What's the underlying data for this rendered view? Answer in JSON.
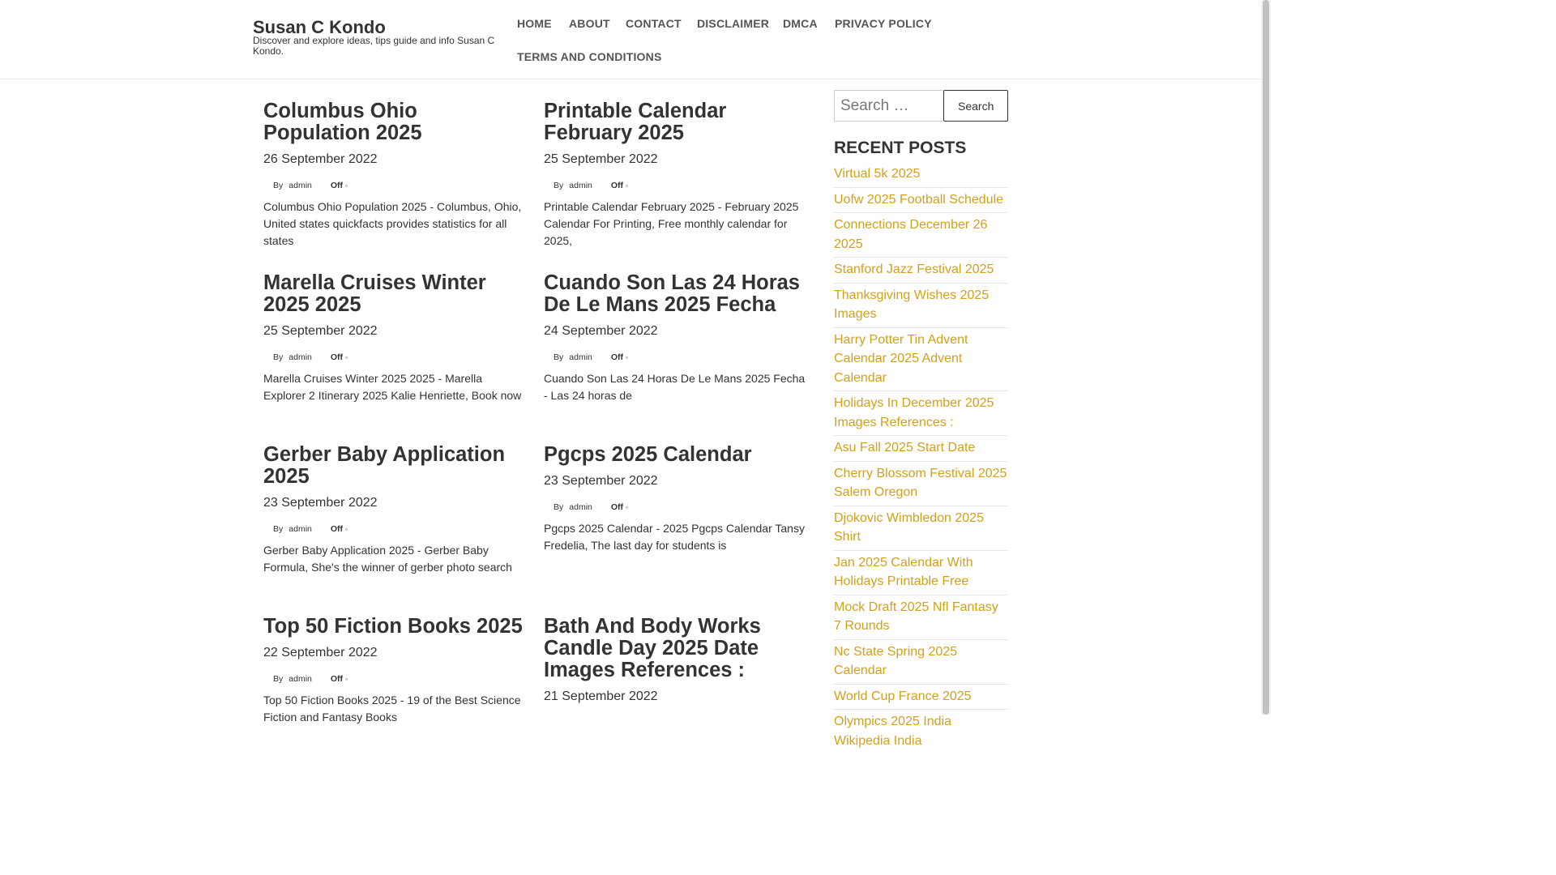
{
  "site": {
    "title": "Susan C Kondo",
    "description": "Discover and explore ideas, tips guide and info Susan C Kondo."
  },
  "nav": {
    "items": [
      "HOME",
      "ABOUT",
      "CONTACT",
      "DISCLAIMER",
      "DMCA",
      "PRIVACY POLICY",
      "TERMS AND CONDITIONS"
    ]
  },
  "posts": [
    {
      "title": "Columbus Ohio Population 2025",
      "date": "26 September 2022",
      "by": "By",
      "author": "admin",
      "comments": "Off",
      "excerpt": "Columbus Ohio Population 2025 - Columbus, Ohio, United states quickfacts provides statistics for all states"
    },
    {
      "title": "Printable Calendar February 2025",
      "date": "25 September 2022",
      "by": "By",
      "author": "admin",
      "comments": "Off",
      "excerpt": "Printable Calendar February 2025 - February 2025 Calendar For Printing, Free monthly calendar for 2025,"
    },
    {
      "title": "Marella Cruises Winter 2025 2025",
      "date": "25 September 2022",
      "by": "By",
      "author": "admin",
      "comments": "Off",
      "excerpt": "Marella Cruises Winter 2025 2025 - Marella Explorer 2 Itinerary 2025 Kalie Henriette, Book now"
    },
    {
      "title": "Cuando Son Las 24 Horas De Le Mans 2025 Fecha",
      "date": "24 September 2022",
      "by": "By",
      "author": "admin",
      "comments": "Off",
      "excerpt": "Cuando Son Las 24 Horas De Le Mans 2025 Fecha - Las 24 horas de"
    },
    {
      "title": "Gerber Baby Application 2025",
      "date": "23 September 2022",
      "by": "By",
      "author": "admin",
      "comments": "Off",
      "excerpt": "Gerber Baby Application 2025 - Gerber Baby Formula, She's the winner of gerber photo search"
    },
    {
      "title": "Pgcps 2025 Calendar",
      "date": "23 September 2022",
      "by": "By",
      "author": "admin",
      "comments": "Off",
      "excerpt": "Pgcps 2025 Calendar - 2025 Pgcps Calendar Tansy Fredelia, The last day for students is"
    },
    {
      "title": "Top 50 Fiction Books 2025",
      "date": "22 September 2022",
      "by": "By",
      "author": "admin",
      "comments": "Off",
      "excerpt": "Top 50 Fiction Books 2025 - 19 of the Best Science Fiction and Fantasy Books"
    },
    {
      "title": "Bath And Body Works Candle Day 2025 Date Images References :",
      "date": "21 September 2022",
      "by": "",
      "author": "",
      "comments": "",
      "excerpt": ""
    }
  ],
  "sidebar": {
    "search_placeholder": "Search …",
    "search_button": "Search",
    "recent_title": "RECENT POSTS",
    "recent_posts": [
      "Virtual 5k 2025",
      "Uofw 2025 Football Schedule",
      "Connections December 26 2025",
      "Stanford Jazz Festival 2025",
      "Thanksgiving Wishes 2025 Images",
      "Harry Potter Tin Advent Calendar 2025 Advent Calendar",
      "Holidays In December 2025 Images References :",
      "Asu Fall 2025 Start Date",
      "Cherry Blossom Festival 2025 Salem Oregon",
      "Djokovic Wimbledon 2025 Shirt",
      "Jan 2025 Calendar With Holidays Printable Free",
      "Mock Draft 2025 Nfl Fantasy 7 Rounds",
      "Nc State Spring 2025 Calendar",
      "World Cup France 2025",
      "Olympics 2025 India Wikipedia India"
    ]
  },
  "colors": {
    "link_accent": "#d4a017",
    "text": "#333333",
    "nav": "#555555"
  },
  "icons": {
    "comment": "comment-icon"
  }
}
